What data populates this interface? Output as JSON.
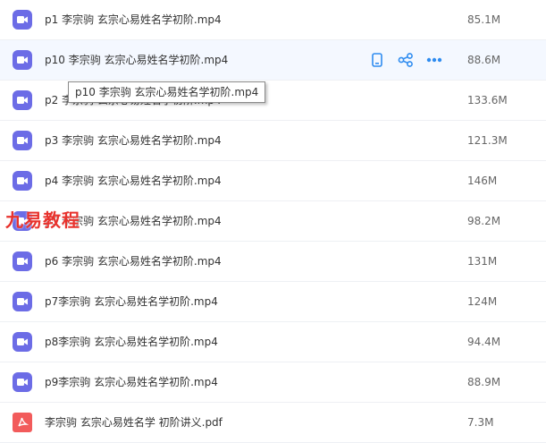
{
  "files": [
    {
      "name": "p1 李宗驹 玄宗心易姓名学初阶.mp4",
      "size": "85.1M",
      "type": "video"
    },
    {
      "name": "p10 李宗驹 玄宗心易姓名学初阶.mp4",
      "size": "88.6M",
      "type": "video"
    },
    {
      "name": "p2 李宗驹 玄宗心易姓名学初阶.mp4",
      "size": "133.6M",
      "type": "video"
    },
    {
      "name": "p3 李宗驹 玄宗心易姓名学初阶.mp4",
      "size": "121.3M",
      "type": "video"
    },
    {
      "name": "p4 李宗驹 玄宗心易姓名学初阶.mp4",
      "size": "146M",
      "type": "video"
    },
    {
      "name": "p5 李宗驹 玄宗心易姓名学初阶.mp4",
      "size": "98.2M",
      "type": "video"
    },
    {
      "name": "p6 李宗驹 玄宗心易姓名学初阶.mp4",
      "size": "131M",
      "type": "video"
    },
    {
      "name": "p7李宗驹 玄宗心易姓名学初阶.mp4",
      "size": "124M",
      "type": "video"
    },
    {
      "name": "p8李宗驹 玄宗心易姓名学初阶.mp4",
      "size": "94.4M",
      "type": "video"
    },
    {
      "name": "p9李宗驹 玄宗心易姓名学初阶.mp4",
      "size": "88.9M",
      "type": "video"
    },
    {
      "name": "李宗驹 玄宗心易姓名学 初阶讲义.pdf",
      "size": "7.3M",
      "type": "pdf"
    }
  ],
  "hovered_index": 1,
  "tooltip": "p10 李宗驹 玄宗心易姓名学初阶.mp4",
  "watermark": "九易教程",
  "colors": {
    "video_icon": "#6c6ce6",
    "pdf_icon": "#f25b5b",
    "action_icon": "#2f8cf0",
    "watermark": "#e8322d"
  },
  "action_icons": [
    "phone-icon",
    "share-icon",
    "more-icon"
  ]
}
